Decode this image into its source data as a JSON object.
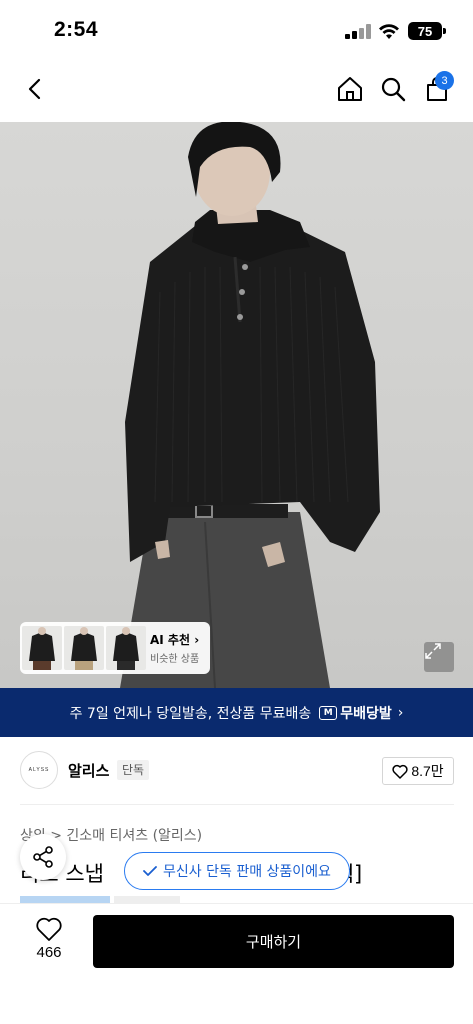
{
  "status_bar": {
    "time": "2:54",
    "battery": "75"
  },
  "nav": {
    "cart_count": "3",
    "icons": [
      "back-icon",
      "home-icon",
      "search-icon",
      "cart-icon"
    ]
  },
  "ai_recommend": {
    "title": "AI 추천",
    "subtitle": "비슷한 상품"
  },
  "delivery_banner": {
    "text": "주 7일 언제나 당일발송, 전상품 무료배송",
    "logo_mark": "M",
    "logo_label": "무배당발"
  },
  "brand": {
    "logo_text": "ALYSS",
    "name": "알리스",
    "tag": "단독",
    "like_count": "8.7만"
  },
  "product": {
    "breadcrumb": "상의 > 긴소매 티셔츠 (알리스)",
    "title_left": "리브 스냅",
    "title_right": "블랙]"
  },
  "toast": {
    "text": "무신사 단독 판매 상품이에요"
  },
  "bottom_bar": {
    "like_count": "466",
    "buy_label": "구매하기"
  },
  "colors": {
    "banner": "#0a2a6e",
    "accent": "#1a72e8",
    "buy_button": "#000000"
  }
}
